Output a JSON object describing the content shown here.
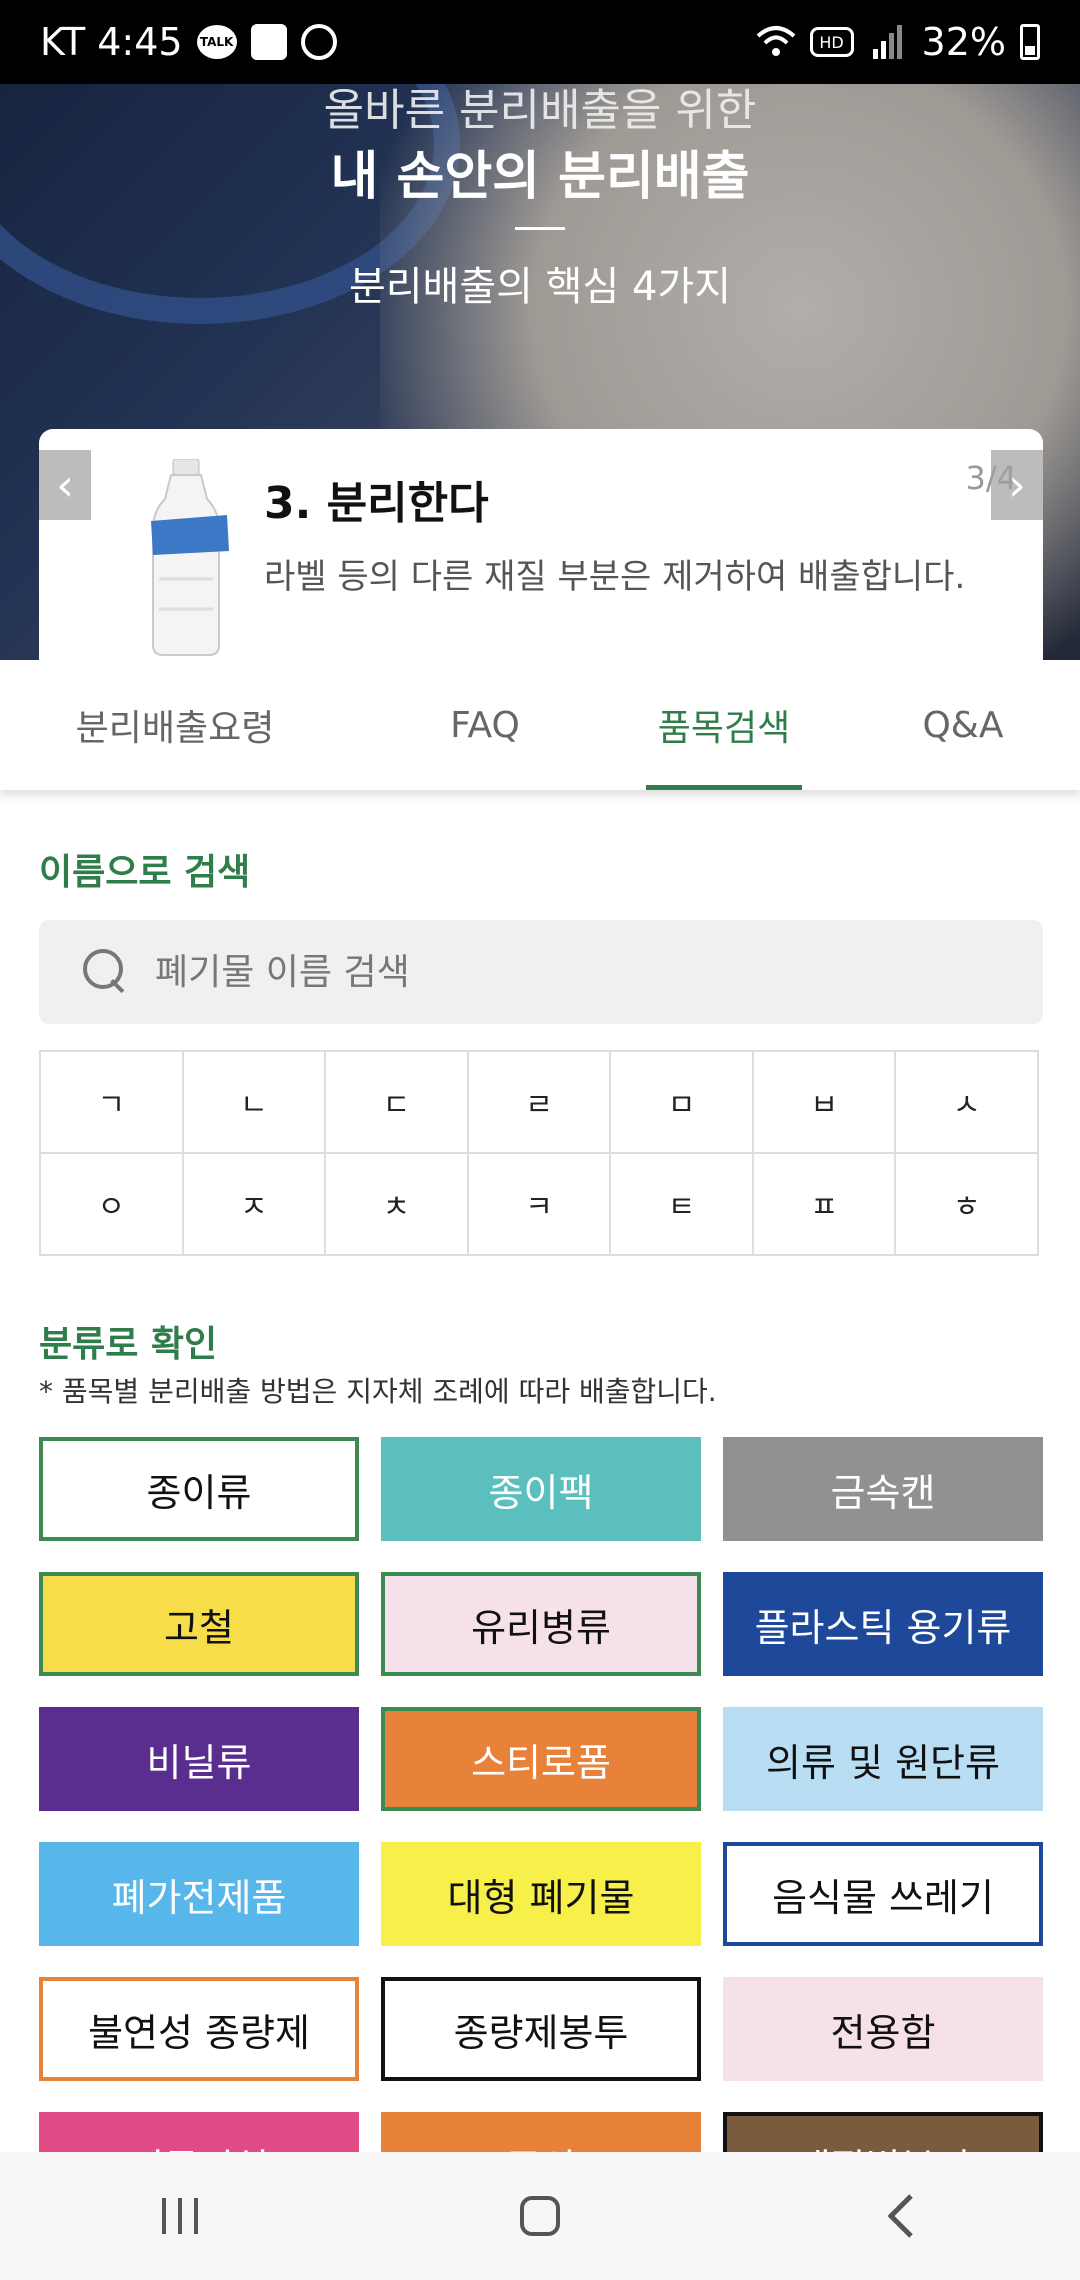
{
  "status_bar": {
    "carrier_time": "KT 4:45",
    "talk_icon_label": "TALK",
    "battery": "32%"
  },
  "hero": {
    "top_text": "올바른 분리배출을 위한",
    "title": "내 손안의 분리배출",
    "subtitle": "분리배출의 핵심 4가지"
  },
  "carousel": {
    "title": "3. 분리한다",
    "description": "라벨 등의 다른 재질 부분은 제거하여 배출합니다.",
    "page": "3/4"
  },
  "tabs": [
    {
      "label": "분리배출요령"
    },
    {
      "label": "FAQ"
    },
    {
      "label": "품목검색"
    },
    {
      "label": "Q&A"
    }
  ],
  "search_section": {
    "title": "이름으로 검색",
    "placeholder": "폐기물 이름 검색",
    "consonants": [
      "ㄱ",
      "ㄴ",
      "ㄷ",
      "ㄹ",
      "ㅁ",
      "ㅂ",
      "ㅅ",
      "ㅇ",
      "ㅈ",
      "ㅊ",
      "ㅋ",
      "ㅌ",
      "ㅍ",
      "ㅎ"
    ]
  },
  "category_section": {
    "title": "분류로 확인",
    "note": "* 품목별 분리배출 방법은 지자체 조례에 따라 배출합니다.",
    "items": [
      {
        "label": "종이류",
        "bg": "#ffffff",
        "border": "#3e8a55",
        "color": "#111111"
      },
      {
        "label": "종이팩",
        "bg": "#5bbfbd",
        "border": "#5bbfbd",
        "color": "#ffffff"
      },
      {
        "label": "금속캔",
        "bg": "#8f9193",
        "border": "#8f9193",
        "color": "#ffffff"
      },
      {
        "label": "고철",
        "bg": "#f8dd4a",
        "border": "#3e8a55",
        "color": "#111111"
      },
      {
        "label": "유리병류",
        "bg": "#f6e1ea",
        "border": "#3e8a55",
        "color": "#111111"
      },
      {
        "label": "플라스틱 용기류",
        "bg": "#1e4899",
        "border": "#1e4899",
        "color": "#ffffff"
      },
      {
        "label": "비닐류",
        "bg": "#5a2e8e",
        "border": "#5a2e8e",
        "color": "#ffffff"
      },
      {
        "label": "스티로폼",
        "bg": "#e8823a",
        "border": "#3e8a55",
        "color": "#ffffff"
      },
      {
        "label": "의류 및 원단류",
        "bg": "#b9def3",
        "border": "#b9def3",
        "color": "#111111"
      },
      {
        "label": "폐가전제품",
        "bg": "#58b7ea",
        "border": "#58b7ea",
        "color": "#ffffff"
      },
      {
        "label": "대형 폐기물",
        "bg": "#f7ef4a",
        "border": "#f7ef4a",
        "color": "#111111"
      },
      {
        "label": "음식물 쓰레기",
        "bg": "#ffffff",
        "border": "#1e4899",
        "color": "#111111"
      },
      {
        "label": "불연성 종량제",
        "bg": "#ffffff",
        "border": "#e8823a",
        "color": "#111111"
      },
      {
        "label": "종량제봉투",
        "bg": "#ffffff",
        "border": "#111111",
        "color": "#111111"
      },
      {
        "label": "전용함",
        "bg": "#f6e1ea",
        "border": "#f6e1ea",
        "color": "#111111"
      },
      {
        "label": "전문시설",
        "bg": "#e04b86",
        "border": "#e04b86",
        "color": "#ffffff"
      },
      {
        "label": "주의",
        "bg": "#e8823a",
        "border": "#e8823a",
        "color": "#ffffff"
      },
      {
        "label": "재질별분리",
        "bg": "#7a5b3d",
        "border": "#111111",
        "color": "#ffffff"
      }
    ]
  }
}
